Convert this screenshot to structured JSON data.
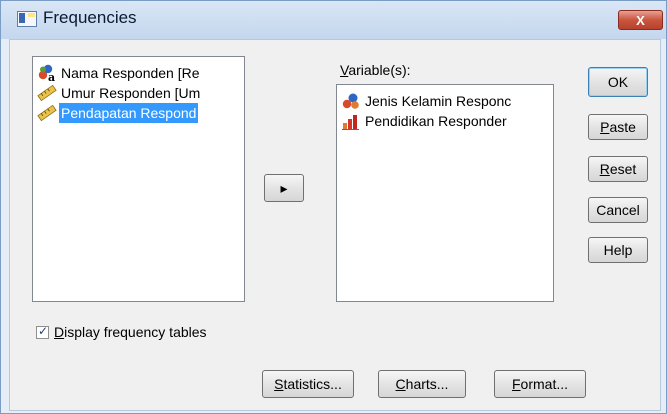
{
  "window": {
    "title": "Frequencies",
    "close_label": "X"
  },
  "source_list": {
    "items": [
      {
        "label": "Nama Responden [Re",
        "icon": "nominal-string-icon",
        "selected": false
      },
      {
        "label": "Umur Responden [Um",
        "icon": "scale-ruler-icon",
        "selected": false
      },
      {
        "label": "Pendapatan Respond",
        "icon": "scale-ruler-icon",
        "selected": true
      }
    ]
  },
  "move_button": {
    "label": "▸"
  },
  "target": {
    "label_prefix": "V",
    "label_rest": "ariable(s):",
    "items": [
      {
        "label": "Jenis Kelamin Responc",
        "icon": "nominal-icon"
      },
      {
        "label": "Pendidikan Responder",
        "icon": "ordinal-bar-icon"
      }
    ]
  },
  "buttons": {
    "ok": "OK",
    "paste_u": "P",
    "paste_rest": "aste",
    "reset_u": "R",
    "reset_rest": "eset",
    "cancel": "Cancel",
    "help": "Help"
  },
  "options": {
    "display_frequency_tables": {
      "checked": true,
      "label_u": "D",
      "label_rest": "isplay frequency tables"
    }
  },
  "bottom_buttons": {
    "statistics_u": "S",
    "statistics_rest": "tatistics...",
    "charts_u": "C",
    "charts_rest": "harts...",
    "format_u": "F",
    "format_rest": "ormat..."
  }
}
